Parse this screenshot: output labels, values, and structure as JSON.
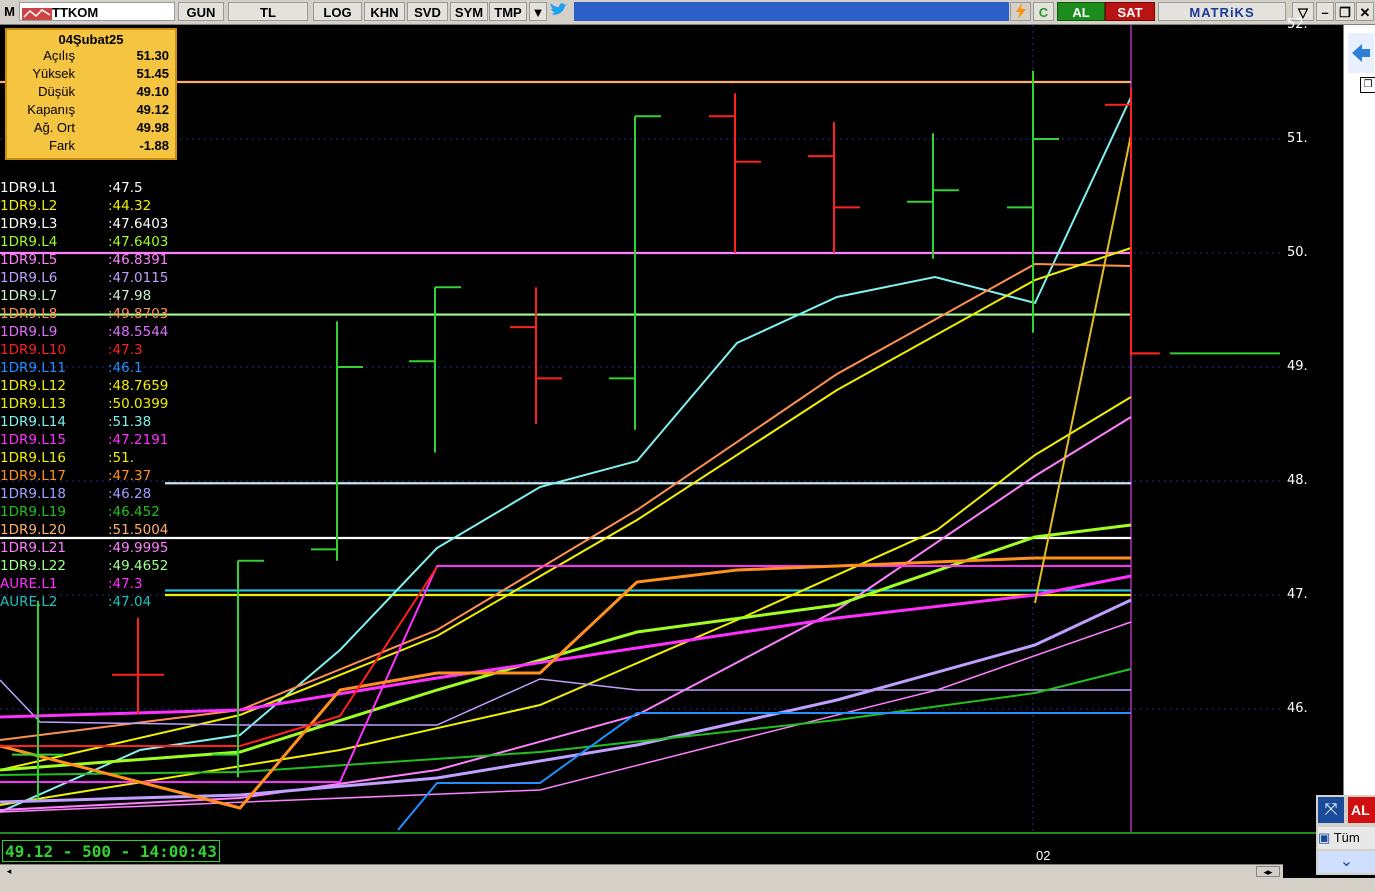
{
  "toolbar": {
    "app_letter": "M",
    "symbol": "TTKOM",
    "buttons": [
      "GUN",
      "TL",
      "LOG",
      "KHN",
      "SVD",
      "SYM",
      "TMP"
    ],
    "buy_label": "AL",
    "sell_label": "SAT",
    "brand": "MATRiKS",
    "c_label": "C"
  },
  "info": {
    "date": "04Şubat25",
    "rows": [
      {
        "label": "Açılış",
        "value": "51.30"
      },
      {
        "label": "Yüksek",
        "value": "51.45"
      },
      {
        "label": "Düşük",
        "value": "49.10"
      },
      {
        "label": "Kapanış",
        "value": "49.12"
      },
      {
        "label": "Ağ. Ort",
        "value": "49.98"
      },
      {
        "label": "Fark",
        "value": "-1.88"
      }
    ]
  },
  "legend": [
    {
      "name": "1DR9.L1",
      "value": ":47.5",
      "color": "#ffffff"
    },
    {
      "name": "1DR9.L2",
      "value": ":44.32",
      "color": "#f0f000"
    },
    {
      "name": "1DR9.L3",
      "value": ":47.6403",
      "color": "#ffffff"
    },
    {
      "name": "1DR9.L4",
      "value": ":47.6403",
      "color": "#a0ff20"
    },
    {
      "name": "1DR9.L5",
      "value": ":46.8391",
      "color": "#ff80ff"
    },
    {
      "name": "1DR9.L6",
      "value": ":47.0115",
      "color": "#c0a0ff"
    },
    {
      "name": "1DR9.L7",
      "value": ":47.98",
      "color": "#d0f0d0"
    },
    {
      "name": "1DR9.L8",
      "value": ":49.8703",
      "color": "#ff9050"
    },
    {
      "name": "1DR9.L9",
      "value": ":48.5544",
      "color": "#e070ff"
    },
    {
      "name": "1DR9.L10",
      "value": ":47.3",
      "color": "#ff2020"
    },
    {
      "name": "1DR9.L11",
      "value": ":46.1",
      "color": "#2090ff"
    },
    {
      "name": "1DR9.L12",
      "value": ":48.7659",
      "color": "#f0f000"
    },
    {
      "name": "1DR9.L13",
      "value": ":50.0399",
      "color": "#f0f000"
    },
    {
      "name": "1DR9.L14",
      "value": ":51.38",
      "color": "#80f0f0"
    },
    {
      "name": "1DR9.L15",
      "value": ":47.2191",
      "color": "#ff30ff"
    },
    {
      "name": "1DR9.L16",
      "value": ":51.",
      "color": "#f0f000"
    },
    {
      "name": "1DR9.L17",
      "value": ":47.37",
      "color": "#ff9020"
    },
    {
      "name": "1DR9.L18",
      "value": ":46.28",
      "color": "#a0a0ff"
    },
    {
      "name": "1DR9.L19",
      "value": ":46.452",
      "color": "#20c020"
    },
    {
      "name": "1DR9.L20",
      "value": ":51.5004",
      "color": "#ffb070"
    },
    {
      "name": "1DR9.L21",
      "value": ":49.9995",
      "color": "#ff80ff"
    },
    {
      "name": "1DR9.L22",
      "value": ":49.4652",
      "color": "#a0ff90"
    },
    {
      "name": "AURE.L1",
      "value": ":47.3",
      "color": "#ff30ff"
    },
    {
      "name": "AURE.L2",
      "value": ":47.04",
      "color": "#20c0c0"
    }
  ],
  "y_axis_labels": [
    "52.",
    "51.",
    "50.",
    "49.",
    "48.",
    "47.",
    "46."
  ],
  "x_axis_label": "02",
  "ticker": "49.12 - 500 - 14:00:43",
  "order_panel": {
    "buy": "AL",
    "all": "Tüm"
  },
  "colors": {
    "up": "#32d232",
    "down": "#ff2020",
    "info_bg": "#f5c542"
  }
}
